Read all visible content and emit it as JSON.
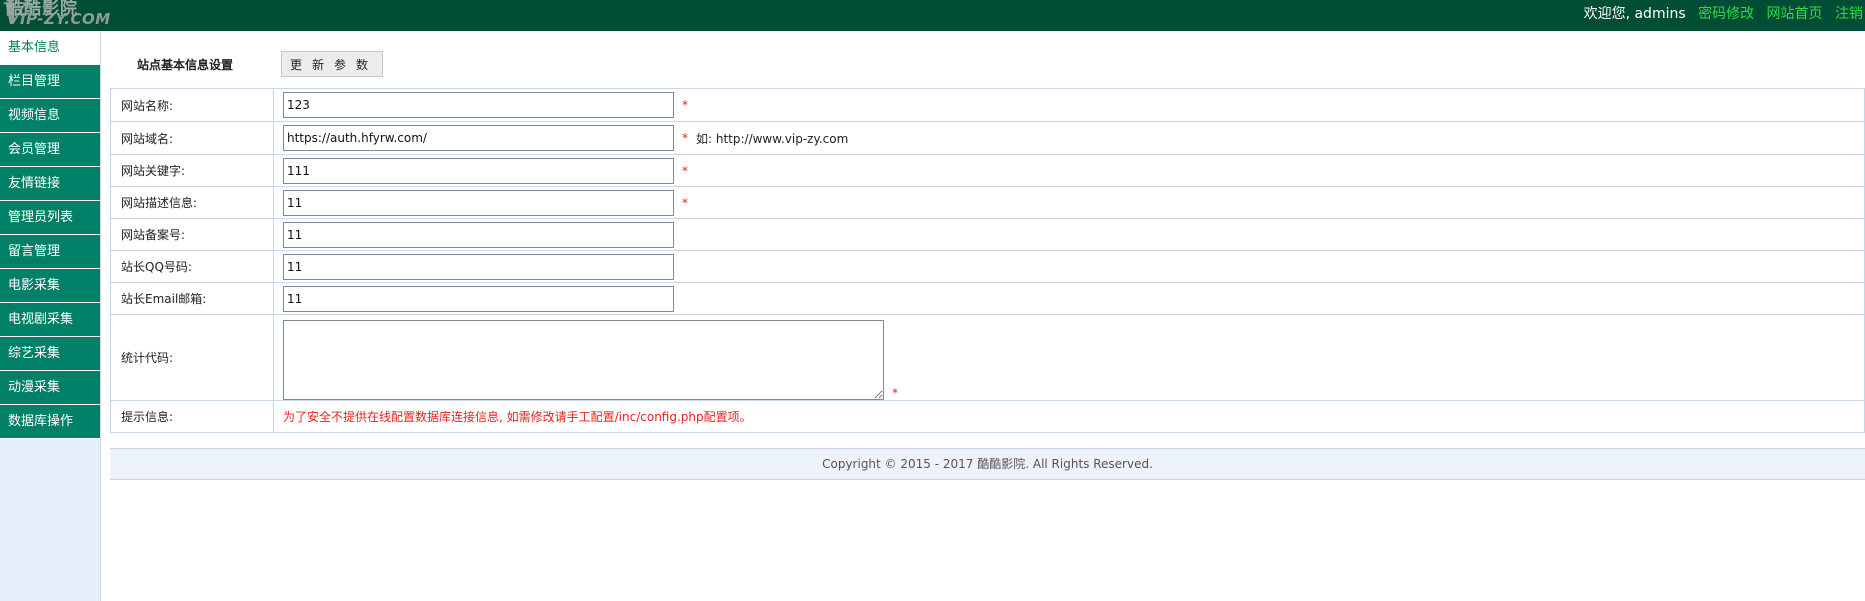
{
  "header": {
    "logo_line1": "酷酷影院",
    "logo_line2": "IP-ZY.COM",
    "logo_v": "V",
    "welcome": "欢迎您, admins",
    "links": [
      "密码修改",
      "网站首页",
      "注销"
    ]
  },
  "sidebar": {
    "items": [
      {
        "label": "基本信息",
        "active": true
      },
      {
        "label": "栏目管理"
      },
      {
        "label": "视频信息"
      },
      {
        "label": "会员管理"
      },
      {
        "label": "友情链接"
      },
      {
        "label": "管理员列表"
      },
      {
        "label": "留言管理"
      },
      {
        "label": "电影采集"
      },
      {
        "label": "电视剧采集"
      },
      {
        "label": "综艺采集"
      },
      {
        "label": "动漫采集"
      },
      {
        "label": "数据库操作"
      }
    ]
  },
  "main": {
    "title": "站点基本信息设置",
    "update_button": "更新参数",
    "fields": {
      "site_name": {
        "label": "网站名称:",
        "value": "123",
        "required": "*"
      },
      "site_domain": {
        "label": "网站域名:",
        "value": "https://auth.hfyrw.com/",
        "required": "*",
        "hint": "如: http://www.vip-zy.com"
      },
      "keywords": {
        "label": "网站关键字:",
        "value": "111",
        "required": "*"
      },
      "description": {
        "label": "网站描述信息:",
        "value": "11",
        "required": "*"
      },
      "icp": {
        "label": "网站备案号:",
        "value": "11"
      },
      "qq": {
        "label": "站长QQ号码:",
        "value": "11"
      },
      "email": {
        "label": "站长Email邮箱:",
        "value": "11"
      },
      "stats_code": {
        "label": "统计代码:",
        "value": "",
        "required": "*"
      },
      "tip": {
        "label": "提示信息:",
        "value": "为了安全不提供在线配置数据库连接信息, 如需修改请手工配置/inc/config.php配置项。"
      }
    },
    "footer": "Copyright © 2015 - 2017 酷酷影院. All Rights Reserved."
  },
  "colors": {
    "header_bg": "#004d36",
    "sidebar_item_bg": "#008066",
    "link_green": "#2edc46",
    "required_red": "#e8231f"
  }
}
